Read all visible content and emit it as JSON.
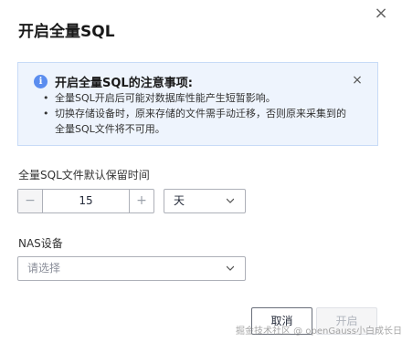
{
  "dialog": {
    "title": "开启全量SQL",
    "close_icon": "close-icon"
  },
  "notice": {
    "icon": "info-icon",
    "title": "开启全量SQL的注意事项:",
    "items": [
      "全量SQL开启后可能对数据库性能产生短暂影响。",
      "切换存储设备时，原来存储的文件需手动迁移，否则原来采集到的全量SQL文件将不可用。"
    ],
    "close_icon": "close-icon"
  },
  "retention": {
    "label": "全量SQL文件默认保留时间",
    "minus": "−",
    "value": "15",
    "plus": "+",
    "unit": "天"
  },
  "nas": {
    "label": "NAS设备",
    "placeholder": "请选择"
  },
  "footer": {
    "cancel_label": "取消",
    "start_label": "开启"
  },
  "watermark": "掘金技术社区 @ openGauss小白成长日记",
  "colors": {
    "notice_bg": "#eef4fd",
    "notice_border": "#c7dbf7",
    "info_icon": "#5b8def",
    "disabled_text": "#b1b5bd"
  }
}
